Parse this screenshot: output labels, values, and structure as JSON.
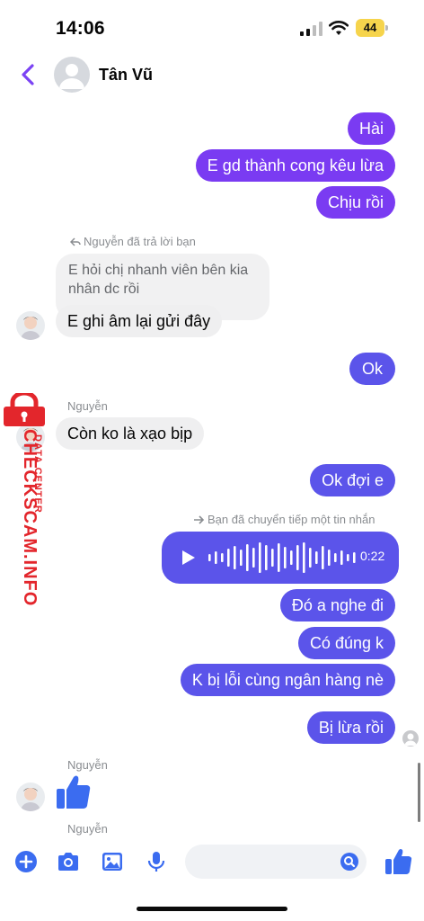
{
  "status_bar": {
    "time": "14:06",
    "battery": "44"
  },
  "header": {
    "contact_name": "Tân Vũ"
  },
  "messages": {
    "m1": "Hài",
    "m2": "E gd thành cong kêu lừa",
    "m3": "Chịu rồi",
    "reply_meta": "Nguyễn đã trả lời bạn",
    "quoted": "E hỏi chị nhanh viên bên kia nhân dc rồi",
    "m4": "E ghi âm lại gửi đây",
    "m5": "Ok",
    "sender1": "Nguyễn",
    "m6": "Còn ko là xạo bịp",
    "m7": "Ok đợi e",
    "forward_meta": "Bạn đã chuyển tiếp một tin nhắn",
    "voice_duration": "0:22",
    "m8": "Đó a nghe đi",
    "m9": "Có đúng k",
    "m10": "K bị lỗi cùng ngân hàng nè",
    "m11": "Bị lừa rồi",
    "sender2": "Nguyễn",
    "sender3": "Nguyễn"
  },
  "watermark": {
    "main": "CHECKSCAM.INFO",
    "sub": "DATA CENTER"
  },
  "composer": {
    "placeholder": ""
  },
  "colors": {
    "outgoing": "#5b54ea",
    "outgoing_violet": "#7a3bf2",
    "incoming": "#efeff0",
    "accent": "#7b43f4",
    "brand_red": "#e3262c"
  },
  "icons": [
    "chevron-left-icon",
    "plus-icon",
    "camera-icon",
    "image-icon",
    "microphone-icon",
    "search-icon",
    "thumbs-up-icon",
    "play-icon",
    "lock-icon"
  ]
}
